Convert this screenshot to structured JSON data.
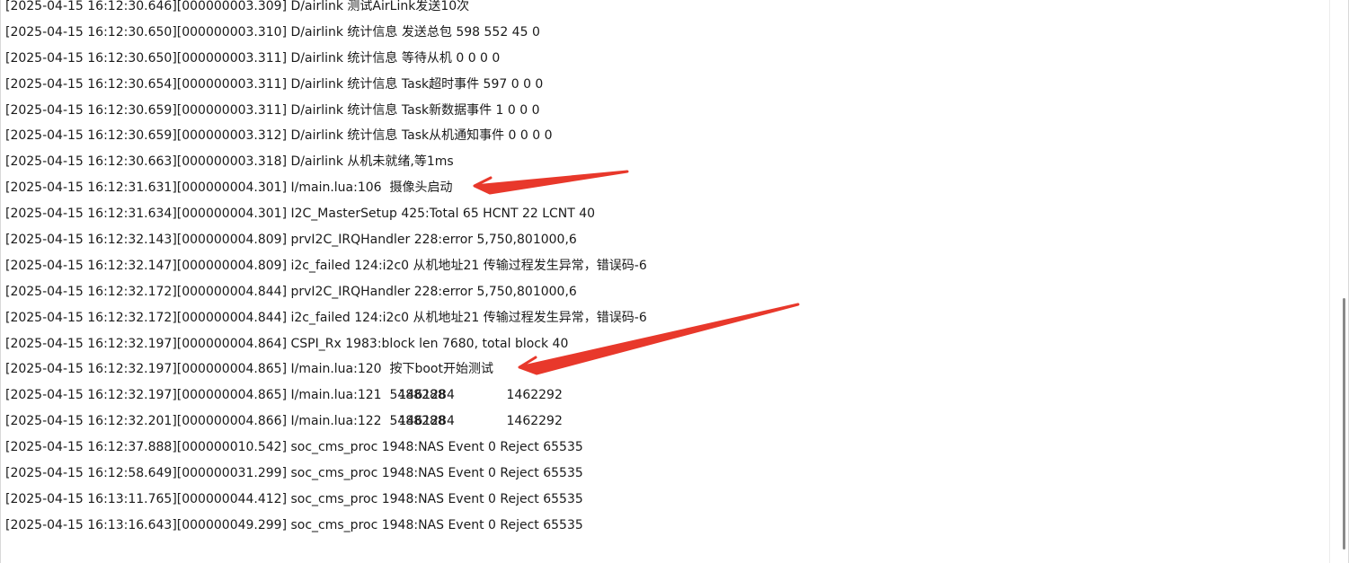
{
  "log": {
    "lines": [
      {
        "ts": "[2025-04-15 16:12:30.646][000000003.309]",
        "msg": "D/airlink 测试AirLink发送10次"
      },
      {
        "ts": "[2025-04-15 16:12:30.650][000000003.310]",
        "msg": "D/airlink 统计信息 发送总包 598 552 45 0"
      },
      {
        "ts": "[2025-04-15 16:12:30.650][000000003.311]",
        "msg": "D/airlink 统计信息 等待从机 0 0 0 0"
      },
      {
        "ts": "[2025-04-15 16:12:30.654][000000003.311]",
        "msg": "D/airlink 统计信息 Task超时事件 597 0 0 0"
      },
      {
        "ts": "[2025-04-15 16:12:30.659][000000003.311]",
        "msg": "D/airlink 统计信息 Task新数据事件 1 0 0 0"
      },
      {
        "ts": "[2025-04-15 16:12:30.659][000000003.312]",
        "msg": "D/airlink 统计信息 Task从机通知事件 0 0 0 0"
      },
      {
        "ts": "[2025-04-15 16:12:30.663][000000003.318]",
        "msg": "D/airlink 从机未就绪,等1ms"
      },
      {
        "ts": "[2025-04-15 16:12:31.631][000000004.301]",
        "msg": "I/main.lua:106  摄像头启动"
      },
      {
        "ts": "[2025-04-15 16:12:31.634][000000004.301]",
        "msg": "I2C_MasterSetup 425:Total 65 HCNT 22 LCNT 40"
      },
      {
        "ts": "[2025-04-15 16:12:32.143][000000004.809]",
        "msg": "prvI2C_IRQHandler 228:error 5,750,801000,6"
      },
      {
        "ts": "[2025-04-15 16:12:32.147][000000004.809]",
        "msg": "i2c_failed 124:i2c0 从机地址21 传输过程发生异常，错误码-6"
      },
      {
        "ts": "[2025-04-15 16:12:32.172][000000004.844]",
        "msg": "prvI2C_IRQHandler 228:error 5,750,801000,6"
      },
      {
        "ts": "[2025-04-15 16:12:32.172][000000004.844]",
        "msg": "i2c_failed 124:i2c0 从机地址21 传输过程发生异常，错误码-6"
      },
      {
        "ts": "[2025-04-15 16:12:32.197][000000004.864]",
        "msg": "CSPI_Rx 1983:block len 7680, total block 40"
      },
      {
        "ts": "[2025-04-15 16:12:32.197][000000004.865]",
        "msg": "I/main.lua:120  按下boot开始测试"
      },
      {
        "ts": "[2025-04-15 16:12:32.197][000000004.865]",
        "msg": "I/main.lua:121  5488288",
        "c2": "1461284",
        "c3": "1462292"
      },
      {
        "ts": "[2025-04-15 16:12:32.201][000000004.866]",
        "msg": "I/main.lua:122  5488288",
        "c2": "1461284",
        "c3": "1462292"
      },
      {
        "ts": "[2025-04-15 16:12:37.888][000000010.542]",
        "msg": "soc_cms_proc 1948:NAS Event 0 Reject 65535"
      },
      {
        "ts": "[2025-04-15 16:12:58.649][000000031.299]",
        "msg": "soc_cms_proc 1948:NAS Event 0 Reject 65535"
      },
      {
        "ts": "[2025-04-15 16:13:11.765][000000044.412]",
        "msg": "soc_cms_proc 1948:NAS Event 0 Reject 65535"
      },
      {
        "ts": "[2025-04-15 16:13:16.643][000000049.299]",
        "msg": "soc_cms_proc 1948:NAS Event 0 Reject 65535"
      }
    ]
  },
  "annotations": {
    "arrow_color": "#e8382b"
  }
}
